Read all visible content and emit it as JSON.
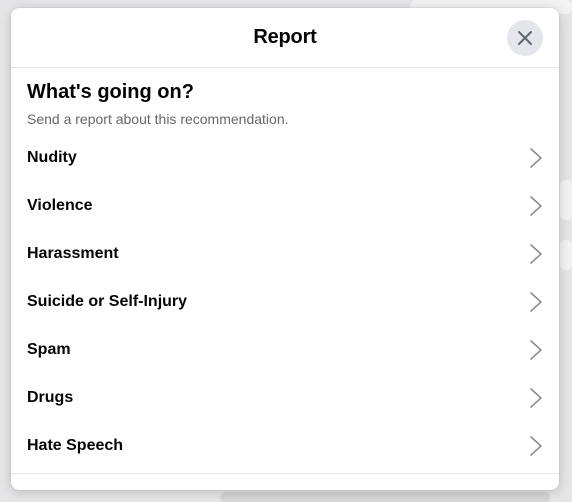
{
  "dialog": {
    "title": "Report",
    "close_icon": "close-icon"
  },
  "intro": {
    "heading": "What's going on?",
    "subtitle": "Send a report about this recommendation."
  },
  "options": [
    {
      "label": "Nudity",
      "icon": "chevron-right-icon"
    },
    {
      "label": "Violence",
      "icon": "chevron-right-icon"
    },
    {
      "label": "Harassment",
      "icon": "chevron-right-icon"
    },
    {
      "label": "Suicide or Self-Injury",
      "icon": "chevron-right-icon"
    },
    {
      "label": "Spam",
      "icon": "chevron-right-icon"
    },
    {
      "label": "Drugs",
      "icon": "chevron-right-icon"
    },
    {
      "label": "Hate Speech",
      "icon": "chevron-right-icon"
    }
  ],
  "colors": {
    "title_text": "#050505",
    "secondary_text": "#65676b",
    "divider": "#e4e6eb",
    "close_button_bg": "#e4e6eb",
    "chevron": "#8a8d91"
  }
}
